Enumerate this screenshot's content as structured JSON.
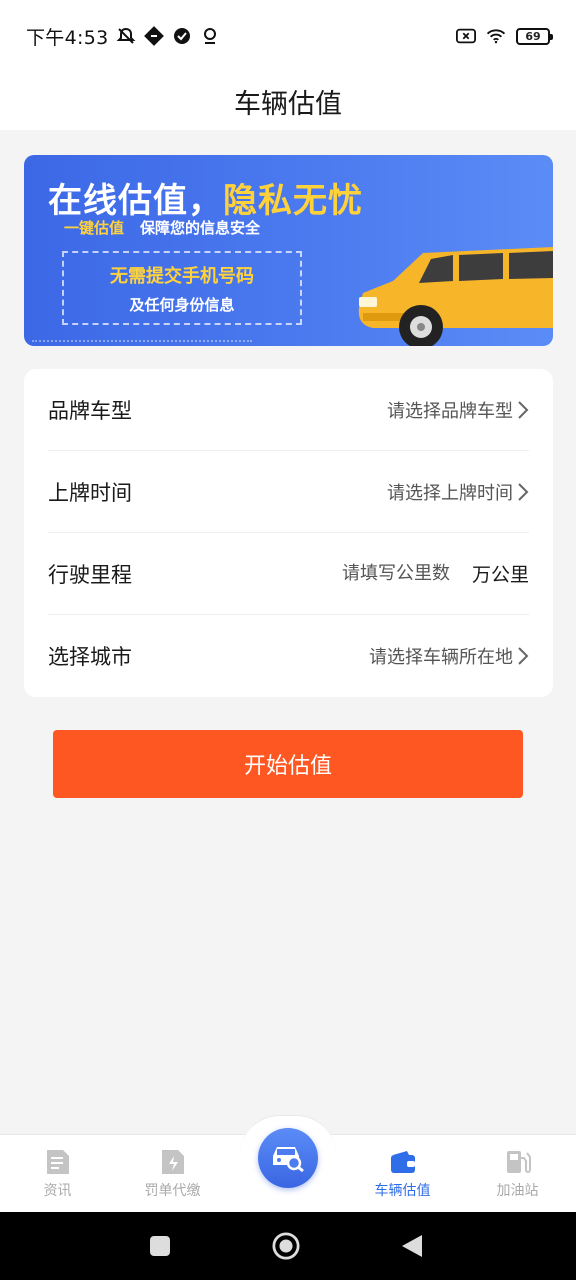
{
  "status_bar": {
    "time": "下午4:53",
    "battery": "69",
    "icons_left": [
      "mute-bell-icon",
      "notification-icon",
      "check-badge-icon",
      "location-icon"
    ],
    "icons_right": [
      "sim-off-icon",
      "wifi-icon",
      "battery-icon"
    ]
  },
  "header": {
    "title": "车辆估值"
  },
  "banner": {
    "title_part1": "在线估值，",
    "title_part2": "隐私无忧",
    "sub_key": "一键估值",
    "sub_text": "保障您的信息安全",
    "box_line1": "无需提交手机号码",
    "box_line2": "及任何身份信息",
    "colors": {
      "bg": "#4d7cf0",
      "highlight": "#ffd23c",
      "car": "#f7b52a"
    }
  },
  "form": {
    "rows": [
      {
        "label": "品牌车型",
        "value": "请选择品牌车型"
      },
      {
        "label": "上牌时间",
        "value": "请选择上牌时间"
      },
      {
        "label": "行驶里程",
        "placeholder": "请填写公里数",
        "unit": "万公里"
      },
      {
        "label": "选择城市",
        "value": "请选择车辆所在地"
      }
    ]
  },
  "start_button": {
    "label": "开始估值",
    "color": "#ff5722"
  },
  "tabbar": {
    "tabs": [
      {
        "label": "资讯",
        "icon": "news-icon"
      },
      {
        "label": "罚单代缴",
        "icon": "ticket-payment-icon"
      },
      {
        "label": "",
        "icon": "car-search-icon"
      },
      {
        "label": "车辆估值",
        "icon": "wallet-icon",
        "active": true
      },
      {
        "label": "加油站",
        "icon": "gas-station-icon"
      }
    ],
    "active_color": "#2f6ee8"
  },
  "system_nav": [
    "recent-apps-icon",
    "home-icon",
    "back-icon"
  ]
}
